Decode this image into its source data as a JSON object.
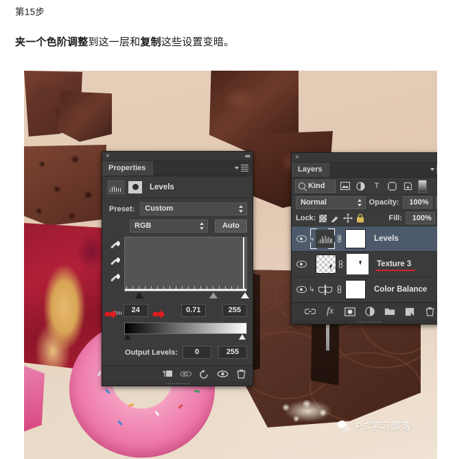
{
  "article": {
    "step_label": "第15步",
    "description_html": "夹一个色阶调整到这一层和复制这些设置变暗。",
    "description_bold_1": "夹一个色阶调整",
    "description_mid": "到这一层和",
    "description_bold_2": "复制",
    "description_tail": "这些设置变暗。"
  },
  "properties_panel": {
    "close_icon": "×",
    "collapse_icon": "◂◂",
    "tab_label": "Properties",
    "adjustment_title": "Levels",
    "preset_label": "Preset:",
    "preset_value": "Custom",
    "channel_value": "RGB",
    "auto_button": "Auto",
    "input_levels": {
      "black": "24",
      "gamma": "0.71",
      "white": "255"
    },
    "output_levels_label": "Output Levels:",
    "output_levels": {
      "black": "0",
      "white": "255"
    },
    "footer_icons": [
      "clip-to-layer-icon",
      "preview-previous-state-icon",
      "reset-icon",
      "toggle-visibility-icon",
      "delete-adjustment-icon"
    ],
    "eyedropper_icons": [
      "black-point-eyedropper-icon",
      "gray-point-eyedropper-icon",
      "white-point-eyedropper-icon"
    ]
  },
  "layers_panel": {
    "close_icon": "×",
    "collapse_icon": "◂◂",
    "tab_label": "Layers",
    "filter": {
      "kind_label": "Kind",
      "icons": [
        "pixel-layer-filter-icon",
        "adjustment-layer-filter-icon",
        "type-layer-filter-icon",
        "shape-layer-filter-icon",
        "smart-object-filter-icon"
      ]
    },
    "blend_mode": "Normal",
    "opacity_label": "Opacity:",
    "opacity_value": "100%",
    "lock_label": "Lock:",
    "lock_icons": [
      "lock-transparent-pixels-icon",
      "lock-image-pixels-icon",
      "lock-position-icon",
      "lock-all-icon"
    ],
    "fill_label": "Fill:",
    "fill_value": "100%",
    "layers": [
      {
        "name": "Levels",
        "type": "adjustment",
        "thumb": "histogram-thumbnail",
        "selected": true,
        "clipped": true,
        "visible": true
      },
      {
        "name": "Texture 3",
        "type": "pixel",
        "thumb": "checkerboard-thumbnail",
        "selected": false,
        "clipped": false,
        "visible": true,
        "annotated": true
      },
      {
        "name": "Color Balance",
        "type": "adjustment",
        "thumb": "balance-scales-thumbnail",
        "selected": false,
        "clipped": true,
        "visible": true
      }
    ],
    "footer_icons": [
      "link-layers-icon",
      "layer-style-fx-icon",
      "add-layer-mask-icon",
      "new-adjustment-layer-icon",
      "new-group-icon",
      "new-layer-icon",
      "delete-layer-icon"
    ]
  },
  "annotations": {
    "arrow_color": "#e01b22",
    "underline_color": "#d81f26",
    "arrow_glyph": "➡",
    "targets": [
      "input-black-field",
      "input-gamma-field",
      "texture-3-layer-name"
    ]
  },
  "watermark": {
    "text": "PS学习部落",
    "icon": "wechat-icon"
  },
  "colors": {
    "canvas_background": "#e6cfba",
    "panel_background": "#3b3b3b",
    "selected_layer": "#4c5a6b",
    "donut_frosting": "#ef7fae",
    "chocolate": "#5d3122"
  }
}
